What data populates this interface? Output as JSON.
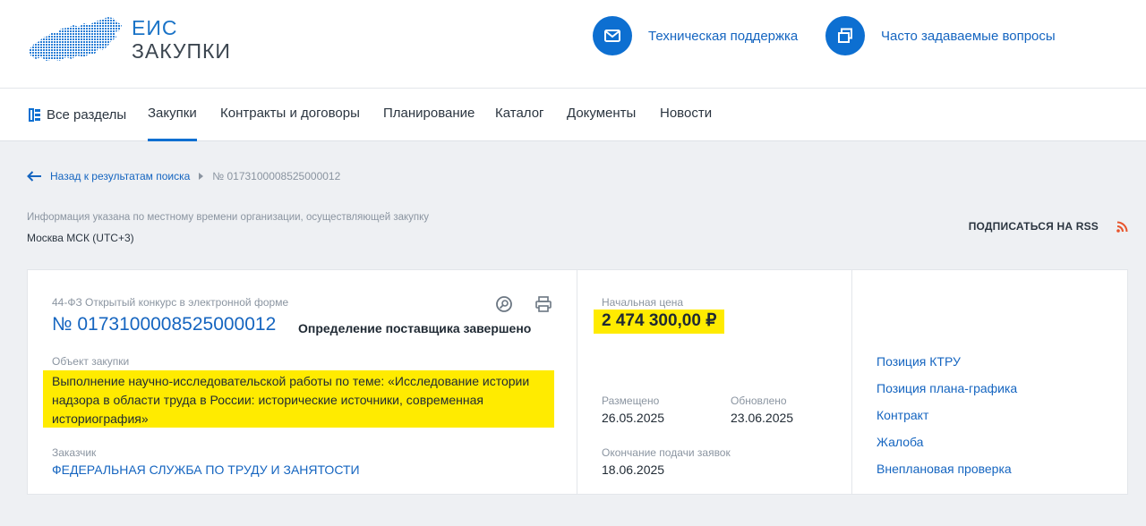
{
  "logo": {
    "line1": "ЕИС",
    "line2": "ЗАКУПКИ"
  },
  "header": {
    "support_label": "Техническая поддержка",
    "faq_label": "Часто задаваемые вопросы"
  },
  "nav": {
    "items": [
      {
        "label": "Все разделы"
      },
      {
        "label": "Закупки"
      },
      {
        "label": "Контракты и договоры"
      },
      {
        "label": "Планирование"
      },
      {
        "label": "Каталог"
      },
      {
        "label": "Документы"
      },
      {
        "label": "Новости"
      }
    ],
    "active": "Закупки"
  },
  "breadcrumb": {
    "back_label": "Назад к результатам поиска",
    "current": "№ 0173100008525000012"
  },
  "timezone": {
    "note": "Информация указана по местному времени организации, осуществляющей закупку",
    "value": "Москва МСК (UTC+3)"
  },
  "rss": {
    "label": "ПОДПИСАТЬСЯ НА RSS"
  },
  "purchase": {
    "law_type": "44-ФЗ Открытый конкурс в электронной форме",
    "number": "№ 0173100008525000012",
    "status": "Определение поставщика завершено",
    "object_label": "Объект закупки",
    "object_lines": [
      "Выполнение научно-исследовательской работы по теме: «Исследование истории",
      "надзора в области труда в России: исторические источники, современная",
      "историография»"
    ],
    "customer_label": "Заказчик",
    "customer": "ФЕДЕРАЛЬНАЯ СЛУЖБА ПО ТРУДУ И ЗАНЯТОСТИ"
  },
  "price": {
    "label": "Начальная цена",
    "value": "2 474 300,00 ₽"
  },
  "dates": {
    "posted_label": "Размещено",
    "posted": "26.05.2025",
    "updated_label": "Обновлено",
    "updated": "23.06.2025",
    "deadline_label": "Окончание подачи заявок",
    "deadline": "18.06.2025"
  },
  "links": [
    {
      "label": "Позиция КТРУ"
    },
    {
      "label": "Позиция плана-графика"
    },
    {
      "label": "Контракт"
    },
    {
      "label": "Жалоба"
    },
    {
      "label": "Внеплановая проверка"
    }
  ],
  "colors": {
    "accent": "#0d6fd1",
    "link": "#1565c0",
    "highlight": "#ffeb00",
    "rss": "#e8542b"
  }
}
